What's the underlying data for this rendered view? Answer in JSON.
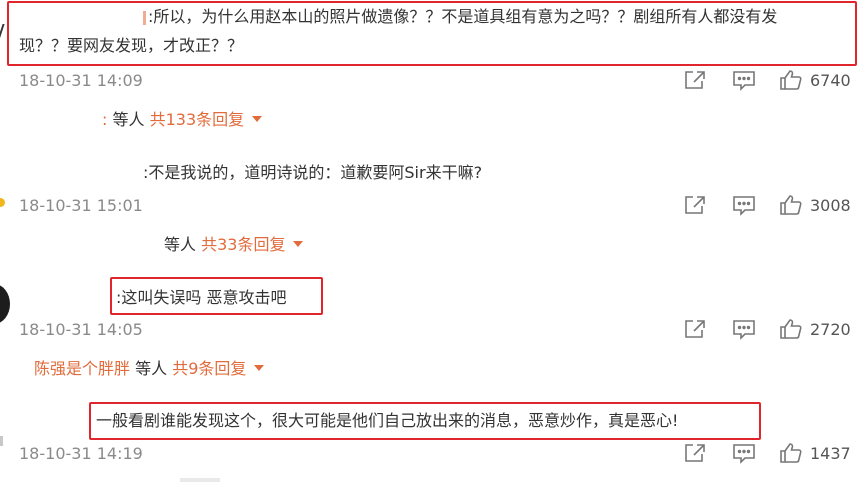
{
  "icons": {
    "share": "share-icon",
    "comment": "comment-icon",
    "like": "like-icon"
  },
  "colors": {
    "highlight": "#e0262c",
    "reply_link": "#e26b3c",
    "timestamp": "#8a8a8a"
  },
  "comments": [
    {
      "text_line1": ":所以，为什么用赵本山的照片做遗像？？不是道具组有意为之吗？？剧组所有人都没有发",
      "text_line2": "现？？要网友发现，才改正？？",
      "time": "18-10-31 14:09",
      "likes": "6740",
      "reply": {
        "user": ":",
        "middle": "等人",
        "link": "共133条回复"
      }
    },
    {
      "text_line1": ":不是我说的，道明诗说的：道歉要阿Sir来干嘛?",
      "time": "18-10-31 15:01",
      "likes": "3008",
      "reply": {
        "user": "",
        "middle": "等人",
        "link": "共33条回复"
      }
    },
    {
      "text_line1": ":这叫失误吗 恶意攻击吧",
      "time": "18-10-31 14:05",
      "likes": "2720",
      "reply": {
        "user": "陈强是个胖胖",
        "middle": "等人",
        "link": "共9条回复"
      }
    },
    {
      "text_line1": "一般看剧谁能发现这个，很大可能是他们自己放出来的消息，恶意炒作，真是恶心!",
      "time": "18-10-31 14:19",
      "likes": "1437"
    }
  ]
}
